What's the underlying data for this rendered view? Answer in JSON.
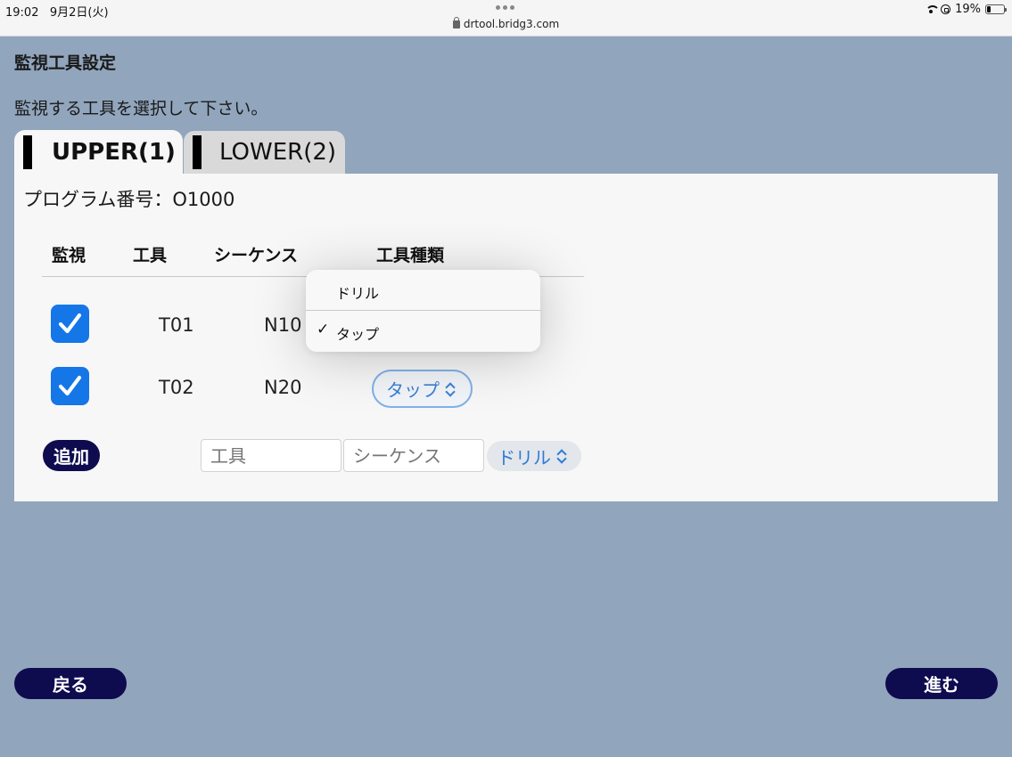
{
  "status_bar": {
    "time": "19:02",
    "date": "9月2日(火)",
    "url": "drtool.bridg3.com",
    "battery": "19%"
  },
  "page": {
    "title": "監視工具設定",
    "instruction": "監視する工具を選択して下さい。"
  },
  "tabs": [
    {
      "label": "UPPER(1)",
      "active": true
    },
    {
      "label": "LOWER(2)",
      "active": false
    }
  ],
  "program": {
    "label": "プログラム番号：O1000"
  },
  "table": {
    "headers": [
      "監視",
      "工具",
      "シーケンス",
      "工具種類"
    ],
    "rows": [
      {
        "monitored": true,
        "tool": "T01",
        "sequence": "N10",
        "type": "タップ"
      },
      {
        "monitored": true,
        "tool": "T02",
        "sequence": "N20",
        "type": "タップ"
      }
    ]
  },
  "add_row": {
    "button": "追加",
    "tool_placeholder": "工具",
    "sequence_placeholder": "シーケンス",
    "type_value": "ドリル"
  },
  "dropdown": {
    "options": [
      "ドリル",
      "タップ"
    ],
    "selected": "タップ"
  },
  "nav": {
    "back": "戻る",
    "next": "進む"
  },
  "colors": {
    "background": "#91a5bd",
    "button": "#0e0b4f",
    "checkbox": "#1576e8",
    "accent": "#3b7fd3"
  }
}
